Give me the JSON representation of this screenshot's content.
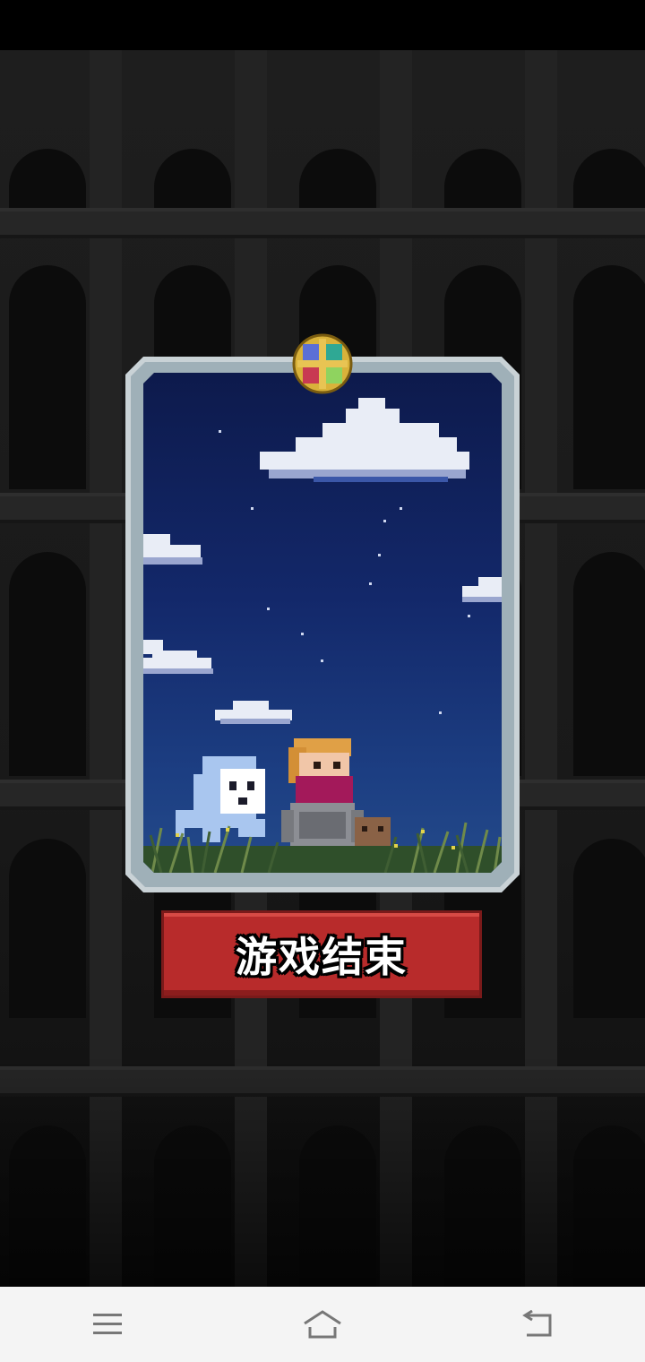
{
  "game": {
    "game_over_label": "游戏结束"
  },
  "navigation": {
    "menu_icon": "menu-icon",
    "home_icon": "home-icon",
    "back_icon": "back-icon"
  },
  "colors": {
    "button_red": "#b82b2b",
    "card_frame": "#c9d2d6",
    "sky_top": "#0d1a4c",
    "nav_bar": "#f4f4f4"
  }
}
